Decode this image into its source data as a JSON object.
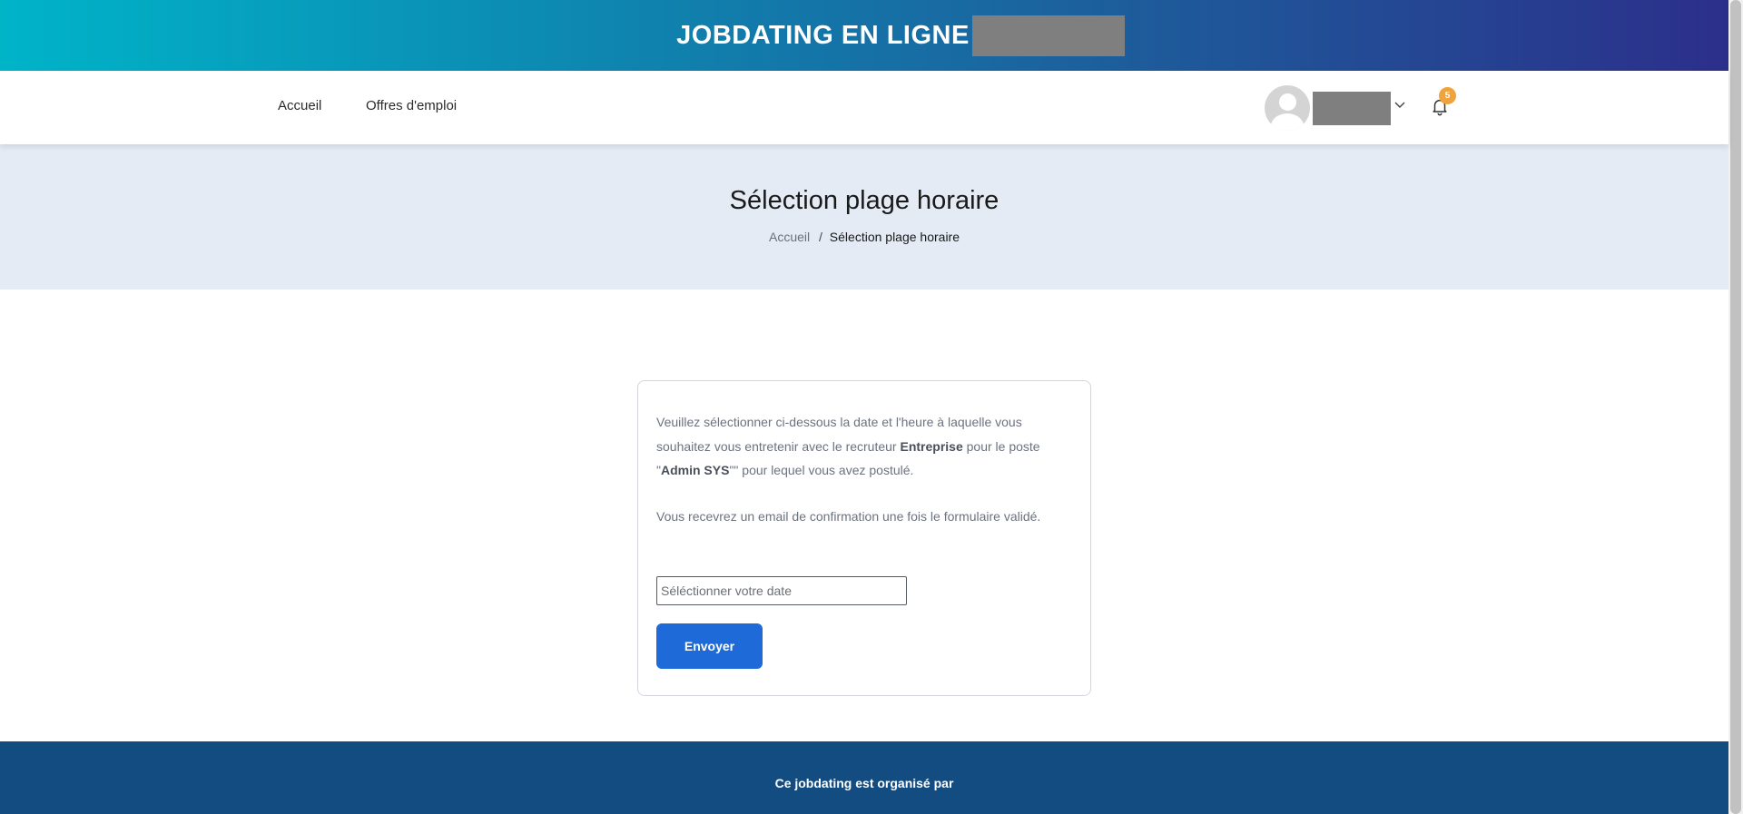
{
  "banner": {
    "title": "JOBDATING EN LIGNE"
  },
  "nav": {
    "links": [
      "Accueil",
      "Offres d'emploi"
    ],
    "notifications_count": "5",
    "icons": {
      "user": "user-avatar-icon",
      "dropdown": "chevron-down-icon",
      "notifications": "bell-icon"
    }
  },
  "hero": {
    "title": "Sélection plage horaire",
    "breadcrumb_home": "Accueil",
    "breadcrumb_sep": "/",
    "breadcrumb_current": "Sélection plage horaire"
  },
  "form": {
    "intro_part1": "Veuillez sélectionner ci-dessous la date et l'heure à laquelle vous souhaitez vous entretenir avec le recruteur ",
    "recruiter": "Entreprise",
    "intro_part2": " pour le poste \"",
    "job_title": "Admin SYS",
    "intro_part3": "\"\" pour lequel vous avez postulé.",
    "confirmation_note": "Vous recevrez un email de confirmation une fois le formulaire validé.",
    "date_placeholder": "Séléctionner votre date",
    "submit_label": "Envoyer"
  },
  "footer": {
    "organizer_text": "Ce jobdating est organisé par"
  },
  "colors": {
    "banner_gradient": [
      "#00b4c8",
      "#2c2f8a"
    ],
    "hero_bg": "#e4ebf5",
    "primary_button": "#1e6ad8",
    "footer_bg": "#124c80",
    "badge": "#f0a33c"
  }
}
